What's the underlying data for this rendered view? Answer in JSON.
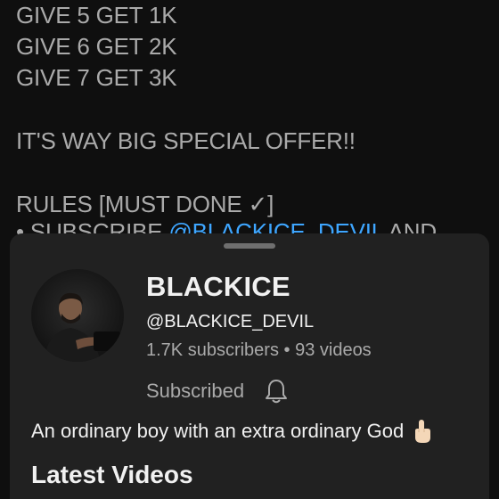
{
  "post": {
    "lines": [
      "GIVE 5 GET 1K",
      "GIVE 6 GET 2K",
      "GIVE 7 GET 3K",
      "IT'S WAY BIG SPECIAL OFFER!!",
      "RULES [MUST DONE ✓]"
    ],
    "partial_line_prefix": "• SUBSCRIBE ",
    "partial_line_link": "@BLACKICE_DEVIL",
    "partial_line_suffix": " AND"
  },
  "channel_sheet": {
    "name": "BLACKICE",
    "handle": "@BLACKICE_DEVIL",
    "stats": "1.7K subscribers • 93 videos",
    "subscribed_label": "Subscribed",
    "description": "An ordinary boy with an extra ordinary God",
    "latest_videos_heading": "Latest Videos"
  },
  "icons": {
    "bell": "bell-icon",
    "finger": "index-pointing-up-icon"
  },
  "colors": {
    "background": "#0f0f0f",
    "sheet": "#212121",
    "link": "#3ea6ff",
    "text_primary": "#f1f1f1",
    "text_secondary": "#aaaaaa"
  }
}
